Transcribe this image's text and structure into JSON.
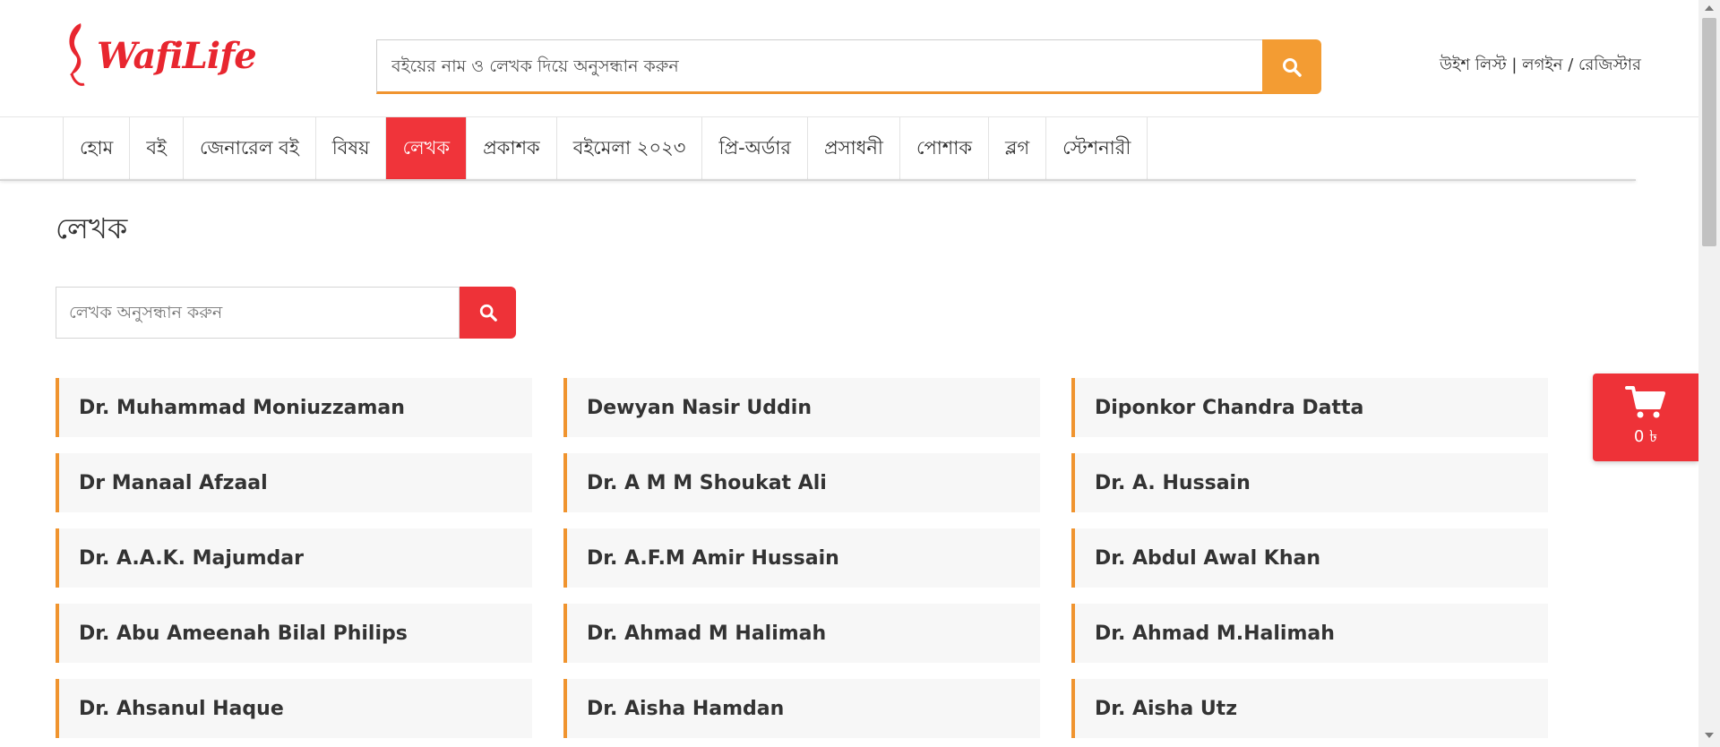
{
  "header": {
    "logo_text": "WafiLife",
    "search_placeholder": "বইয়ের নাম ও লেখক দিয়ে অনুসন্ধান করুন",
    "wishlist_label": "উইশ লিস্ট",
    "separator": " | ",
    "login_label": "লগইন",
    "slash": " / ",
    "register_label": "রেজিস্টার"
  },
  "nav": {
    "items": [
      {
        "label": "হোম"
      },
      {
        "label": "বই"
      },
      {
        "label": "জেনারেল বই"
      },
      {
        "label": "বিষয়"
      },
      {
        "label": "লেখক",
        "active": true
      },
      {
        "label": "প্রকাশক"
      },
      {
        "label": "বইমেলা ২০২৩"
      },
      {
        "label": "প্রি-অর্ডার"
      },
      {
        "label": "প্রসাধনী"
      },
      {
        "label": "পোশাক"
      },
      {
        "label": "ব্লগ"
      },
      {
        "label": "স্টেশনারী"
      }
    ]
  },
  "page": {
    "title": "লেখক",
    "author_search_placeholder": "লেখক অনুসন্ধান করুন"
  },
  "authors": [
    " Dr. Muhammad Moniuzzaman",
    "Dewyan Nasir Uddin",
    "Diponkor Chandra Datta",
    "Dr Manaal Afzaal",
    "Dr. A M M Shoukat Ali",
    "Dr. A. Hussain",
    "Dr. A.A.K. Majumdar",
    "Dr. A.F.M Amir Hussain",
    "Dr. Abdul Awal Khan",
    "Dr. Abu Ameenah Bilal Philips",
    "Dr. Ahmad M Halimah",
    "Dr. Ahmad M.Halimah",
    "Dr. Ahsanul Haque",
    "Dr. Aisha Hamdan",
    "Dr. Aisha Utz"
  ],
  "cart": {
    "count_label": "0 ৳"
  },
  "colors": {
    "brand_red": "#ee3238",
    "accent_orange": "#f39c33"
  },
  "icons": {
    "search": "search-icon",
    "cart": "cart-icon",
    "logo": "logo-icon"
  }
}
